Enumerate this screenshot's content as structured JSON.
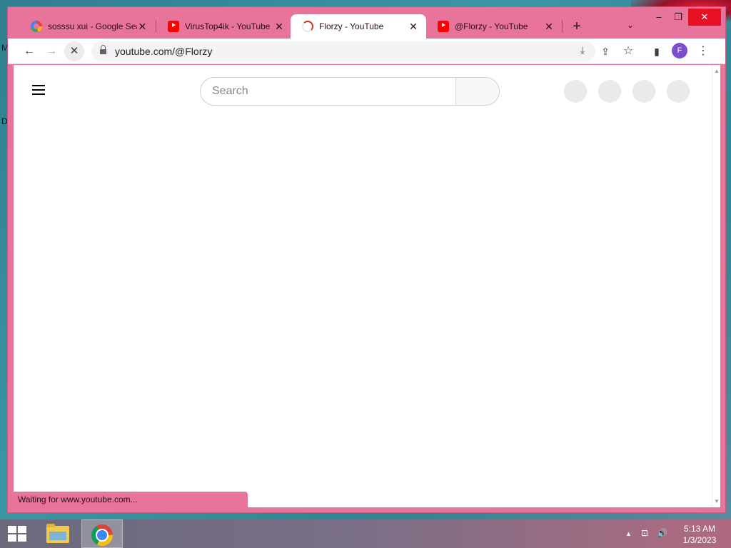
{
  "desktop": {
    "letters": [
      "M",
      "D"
    ]
  },
  "browser": {
    "tabs": [
      {
        "title": "sosssu xui - Google Sea",
        "icon": "google-icon",
        "active": false
      },
      {
        "title": "VirusTop4ik - YouTube",
        "icon": "youtube-icon",
        "active": false
      },
      {
        "title": "Florzy - YouTube",
        "icon": "loading-icon",
        "active": true
      },
      {
        "title": "@Florzy - YouTube",
        "icon": "youtube-icon",
        "active": false
      }
    ],
    "new_tab_glyph": "+",
    "tab_search_glyph": "⌄",
    "window_controls": {
      "minimize": "–",
      "maximize": "❐",
      "close": "✕"
    },
    "toolbar": {
      "back": "←",
      "forward": "→",
      "stop": "✕",
      "url": "youtube.com/@Florzy",
      "install_icon": "⤓",
      "share_icon": "⇪",
      "star_icon": "☆",
      "sidepanel_icon": "▮",
      "profile_initial": "F",
      "menu_icon": "⋮"
    },
    "status_text": "Waiting for www.youtube.com..."
  },
  "youtube": {
    "search_placeholder": "Search",
    "placeholder_circles": 4
  },
  "taskbar": {
    "apps": [
      "file-explorer",
      "google-chrome"
    ],
    "tray": {
      "chevron": "▲",
      "network": "⊡",
      "volume": "🔊"
    },
    "clock": {
      "time": "5:13 AM",
      "date": "1/3/2023"
    }
  },
  "colors": {
    "window_frame": "#e8739b",
    "close_button": "#e81123",
    "profile_avatar": "#7c4dcc"
  }
}
